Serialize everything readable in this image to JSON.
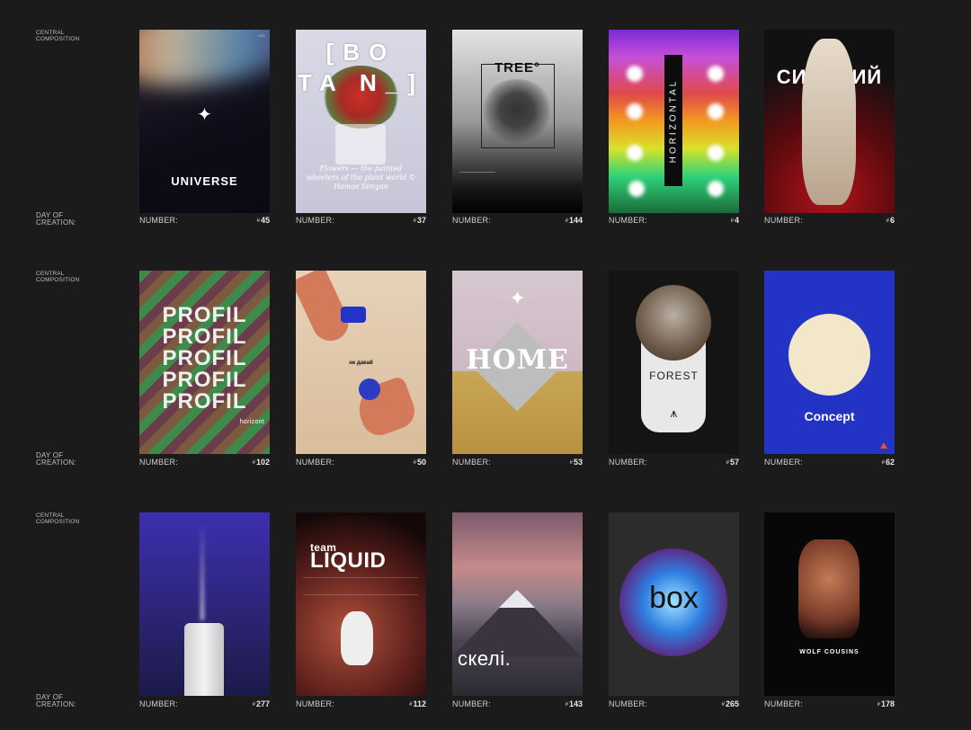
{
  "rows": [
    {
      "central_label": "CENTRAL\nCOMPOSITION",
      "day_label": "DAY OF\nCREATION:",
      "posters": [
        {
          "number_label": "NUMBER:",
          "hash": "#",
          "number": "45",
          "title": "UNIVERSE",
          "corner": "#45"
        },
        {
          "number_label": "NUMBER:",
          "hash": "#",
          "number": "37",
          "title": "[BO TA N_]",
          "script": "Flowers — the painted wheelers of the plant world © Hamos Simyan"
        },
        {
          "number_label": "NUMBER:",
          "hash": "#",
          "number": "144",
          "title": "TREE°"
        },
        {
          "number_label": "NUMBER:",
          "hash": "#",
          "number": "4",
          "title": "HORIZONTAL"
        },
        {
          "number_label": "NUMBER:",
          "hash": "#",
          "number": "6",
          "title": "СИЛЬНИЙ"
        }
      ]
    },
    {
      "central_label": "CENTRAL\nCOMPOSITION",
      "day_label": "DAY OF\nCREATION:",
      "posters": [
        {
          "number_label": "NUMBER:",
          "hash": "#",
          "number": "102",
          "title": "PROFIL",
          "sub": "horizont"
        },
        {
          "number_label": "NUMBER:",
          "hash": "#",
          "number": "50",
          "title": "не давай"
        },
        {
          "number_label": "NUMBER:",
          "hash": "#",
          "number": "53",
          "title": "HOME"
        },
        {
          "number_label": "NUMBER:",
          "hash": "#",
          "number": "57",
          "title": "FOREST"
        },
        {
          "number_label": "NUMBER:",
          "hash": "#",
          "number": "62",
          "title": "Concept"
        }
      ]
    },
    {
      "central_label": "CENTRAL\nCOMPOSITION",
      "day_label": "DAY OF\nCREATION:",
      "posters": [
        {
          "number_label": "NUMBER:",
          "hash": "#",
          "number": "277",
          "title": ""
        },
        {
          "number_label": "NUMBER:",
          "hash": "#",
          "number": "112",
          "title": "LIQUID",
          "pre": "team"
        },
        {
          "number_label": "NUMBER:",
          "hash": "#",
          "number": "143",
          "title": "скелі."
        },
        {
          "number_label": "NUMBER:",
          "hash": "#",
          "number": "265",
          "title": "box"
        },
        {
          "number_label": "NUMBER:",
          "hash": "#",
          "number": "178",
          "title": "WOLF COUSINS"
        }
      ]
    }
  ]
}
